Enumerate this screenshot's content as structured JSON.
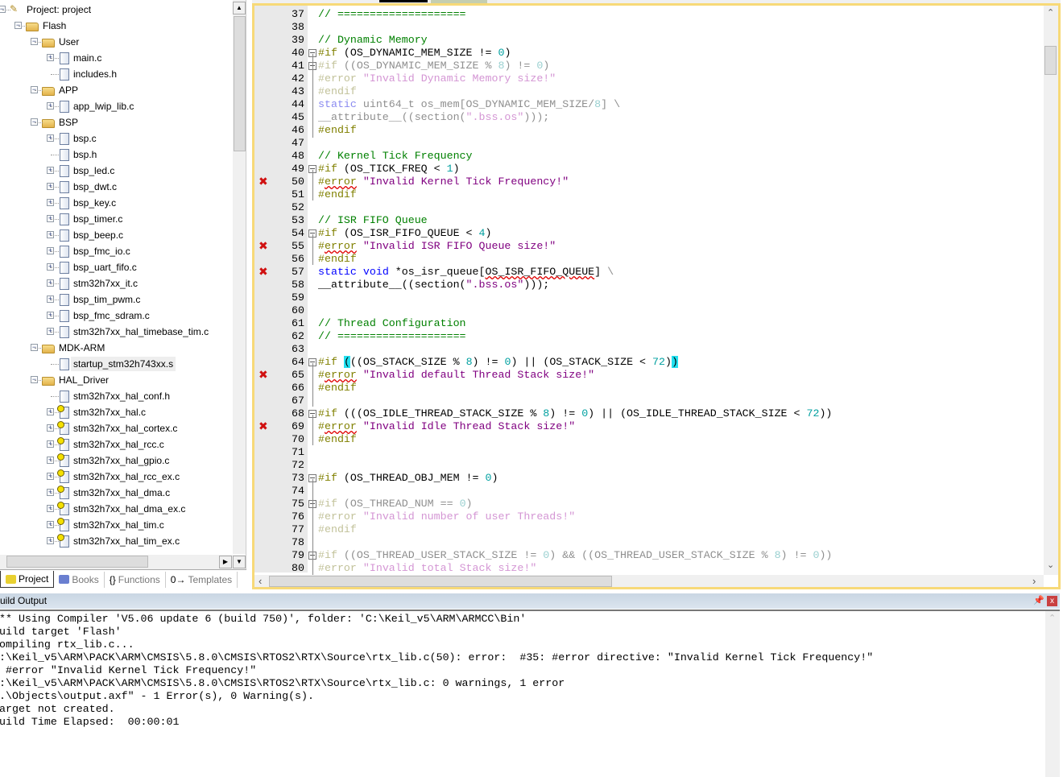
{
  "project_tree": [
    {
      "level": 0,
      "type": "project",
      "label": "Project: project",
      "exp": "-"
    },
    {
      "level": 1,
      "type": "target",
      "label": "Flash",
      "exp": "-"
    },
    {
      "level": 2,
      "type": "folder",
      "label": "User",
      "exp": "-"
    },
    {
      "level": 3,
      "type": "file",
      "label": "main.c",
      "exp": "+"
    },
    {
      "level": 3,
      "type": "file",
      "label": "includes.h",
      "exp": ""
    },
    {
      "level": 2,
      "type": "folder",
      "label": "APP",
      "exp": "-"
    },
    {
      "level": 3,
      "type": "file",
      "label": "app_lwip_lib.c",
      "exp": "+"
    },
    {
      "level": 2,
      "type": "folder",
      "label": "BSP",
      "exp": "-"
    },
    {
      "level": 3,
      "type": "file",
      "label": "bsp.c",
      "exp": "+"
    },
    {
      "level": 3,
      "type": "file",
      "label": "bsp.h",
      "exp": ""
    },
    {
      "level": 3,
      "type": "file",
      "label": "bsp_led.c",
      "exp": "+"
    },
    {
      "level": 3,
      "type": "file",
      "label": "bsp_dwt.c",
      "exp": "+"
    },
    {
      "level": 3,
      "type": "file",
      "label": "bsp_key.c",
      "exp": "+"
    },
    {
      "level": 3,
      "type": "file",
      "label": "bsp_timer.c",
      "exp": "+"
    },
    {
      "level": 3,
      "type": "file",
      "label": "bsp_beep.c",
      "exp": "+"
    },
    {
      "level": 3,
      "type": "file",
      "label": "bsp_fmc_io.c",
      "exp": "+"
    },
    {
      "level": 3,
      "type": "file",
      "label": "bsp_uart_fifo.c",
      "exp": "+"
    },
    {
      "level": 3,
      "type": "file",
      "label": "stm32h7xx_it.c",
      "exp": "+"
    },
    {
      "level": 3,
      "type": "file",
      "label": "bsp_tim_pwm.c",
      "exp": "+"
    },
    {
      "level": 3,
      "type": "file",
      "label": "bsp_fmc_sdram.c",
      "exp": "+"
    },
    {
      "level": 3,
      "type": "file",
      "label": "stm32h7xx_hal_timebase_tim.c",
      "exp": "+"
    },
    {
      "level": 2,
      "type": "folder",
      "label": "MDK-ARM",
      "exp": "-"
    },
    {
      "level": 3,
      "type": "file",
      "label": "startup_stm32h743xx.s",
      "exp": "",
      "selected": true
    },
    {
      "level": 2,
      "type": "folder",
      "label": "HAL_Driver",
      "exp": "-"
    },
    {
      "level": 3,
      "type": "file",
      "label": "stm32h7xx_hal_conf.h",
      "exp": ""
    },
    {
      "level": 3,
      "type": "keyfile",
      "label": "stm32h7xx_hal.c",
      "exp": "+"
    },
    {
      "level": 3,
      "type": "keyfile",
      "label": "stm32h7xx_hal_cortex.c",
      "exp": "+"
    },
    {
      "level": 3,
      "type": "keyfile",
      "label": "stm32h7xx_hal_rcc.c",
      "exp": "+"
    },
    {
      "level": 3,
      "type": "keyfile",
      "label": "stm32h7xx_hal_gpio.c",
      "exp": "+"
    },
    {
      "level": 3,
      "type": "keyfile",
      "label": "stm32h7xx_hal_rcc_ex.c",
      "exp": "+"
    },
    {
      "level": 3,
      "type": "keyfile",
      "label": "stm32h7xx_hal_dma.c",
      "exp": "+"
    },
    {
      "level": 3,
      "type": "keyfile",
      "label": "stm32h7xx_hal_dma_ex.c",
      "exp": "+"
    },
    {
      "level": 3,
      "type": "keyfile",
      "label": "stm32h7xx_hal_tim.c",
      "exp": "+"
    },
    {
      "level": 3,
      "type": "keyfile",
      "label": "stm32h7xx_hal_tim_ex.c",
      "exp": "+"
    }
  ],
  "left_tabs": [
    {
      "label": "Project",
      "icon": "project-icon",
      "active": true
    },
    {
      "label": "Books",
      "icon": "books-icon"
    },
    {
      "label": "Functions",
      "icon": "functions-icon",
      "glyph": "{}"
    },
    {
      "label": "Templates",
      "icon": "templates-icon",
      "glyph": "0→"
    }
  ],
  "editor": {
    "lines": [
      {
        "n": "37",
        "tokens": [
          [
            "c",
            "// ===================="
          ]
        ]
      },
      {
        "n": "38",
        "tokens": []
      },
      {
        "n": "39",
        "tokens": [
          [
            "c",
            "// Dynamic Memory"
          ]
        ]
      },
      {
        "n": "40",
        "fold": "box",
        "tokens": [
          [
            "p",
            "#if"
          ],
          [
            "t",
            " (OS_DYNAMIC_MEM_SIZE != "
          ],
          [
            "n",
            "0"
          ],
          [
            "t",
            ")"
          ]
        ]
      },
      {
        "n": "41",
        "fold": "box",
        "tokens": [
          [
            "pi",
            "#if"
          ],
          [
            "ti",
            " ((OS_DYNAMIC_MEM_SIZE % "
          ],
          [
            "ni",
            "8"
          ],
          [
            "ti",
            ") != "
          ],
          [
            "ni",
            "0"
          ],
          [
            "ti",
            ")"
          ]
        ]
      },
      {
        "n": "42",
        "tokens": [
          [
            "pi",
            "#error"
          ],
          [
            "ti",
            " "
          ],
          [
            "si",
            "\"Invalid Dynamic Memory size!\""
          ]
        ]
      },
      {
        "n": "43",
        "tokens": [
          [
            "pi",
            "#endif"
          ]
        ]
      },
      {
        "n": "44",
        "tokens": [
          [
            "ki",
            "static"
          ],
          [
            "ti",
            " uint64_t os_mem[OS_DYNAMIC_MEM_SIZE/"
          ],
          [
            "ni",
            "8"
          ],
          [
            "ti",
            "] \\"
          ]
        ]
      },
      {
        "n": "45",
        "tokens": [
          [
            "ti",
            "__attribute__((section("
          ],
          [
            "si",
            "\".bss.os\""
          ],
          [
            "ti",
            ")));"
          ]
        ]
      },
      {
        "n": "46",
        "tokens": [
          [
            "p",
            "#endif"
          ]
        ]
      },
      {
        "n": "47",
        "tokens": []
      },
      {
        "n": "48",
        "tokens": [
          [
            "c",
            "// Kernel Tick Frequency"
          ]
        ]
      },
      {
        "n": "49",
        "fold": "box",
        "tokens": [
          [
            "p",
            "#if"
          ],
          [
            "t",
            " (OS_TICK_FREQ < "
          ],
          [
            "n",
            "1"
          ],
          [
            "t",
            ")"
          ]
        ]
      },
      {
        "n": "50",
        "error": true,
        "tokens": [
          [
            "p",
            "#"
          ],
          [
            "pe",
            "error"
          ],
          [
            "t",
            " "
          ],
          [
            "s",
            "\"Invalid Kernel Tick Frequency!\""
          ]
        ]
      },
      {
        "n": "51",
        "tokens": [
          [
            "p",
            "#endif"
          ]
        ]
      },
      {
        "n": "52",
        "tokens": []
      },
      {
        "n": "53",
        "tokens": [
          [
            "c",
            "// ISR FIFO Queue"
          ]
        ]
      },
      {
        "n": "54",
        "fold": "box",
        "tokens": [
          [
            "p",
            "#if"
          ],
          [
            "t",
            " (OS_ISR_FIFO_QUEUE < "
          ],
          [
            "n",
            "4"
          ],
          [
            "t",
            ")"
          ]
        ]
      },
      {
        "n": "55",
        "error": true,
        "tokens": [
          [
            "p",
            "#"
          ],
          [
            "pe",
            "error"
          ],
          [
            "t",
            " "
          ],
          [
            "s",
            "\"Invalid ISR FIFO Queue size!\""
          ]
        ]
      },
      {
        "n": "56",
        "tokens": [
          [
            "p",
            "#endif"
          ]
        ]
      },
      {
        "n": "57",
        "error": true,
        "tokens": [
          [
            "k",
            "static"
          ],
          [
            "t",
            " "
          ],
          [
            "k",
            "void"
          ],
          [
            "t",
            " *os_isr_queue["
          ],
          [
            "te",
            "OS_ISR_FIFO_QUEUE"
          ],
          [
            "t",
            "] "
          ],
          [
            "ti",
            "\\"
          ]
        ]
      },
      {
        "n": "58",
        "tokens": [
          [
            "t",
            "__attribute__((section("
          ],
          [
            "s",
            "\".bss.os\""
          ],
          [
            "t",
            ")));"
          ]
        ]
      },
      {
        "n": "59",
        "tokens": []
      },
      {
        "n": "60",
        "tokens": []
      },
      {
        "n": "61",
        "tokens": [
          [
            "c",
            "// Thread Configuration"
          ]
        ]
      },
      {
        "n": "62",
        "tokens": [
          [
            "c",
            "// ===================="
          ]
        ]
      },
      {
        "n": "63",
        "tokens": []
      },
      {
        "n": "64",
        "fold": "box",
        "tokens": [
          [
            "p",
            "#if"
          ],
          [
            "t",
            " "
          ],
          [
            "h",
            "("
          ],
          [
            "t",
            "((OS_STACK_SIZE % "
          ],
          [
            "n",
            "8"
          ],
          [
            "t",
            ") != "
          ],
          [
            "n",
            "0"
          ],
          [
            "t",
            ") || (OS_STACK_SIZE < "
          ],
          [
            "n",
            "72"
          ],
          [
            "t",
            ")"
          ],
          [
            "h",
            ")"
          ]
        ]
      },
      {
        "n": "65",
        "error": true,
        "tokens": [
          [
            "p",
            "#"
          ],
          [
            "pe",
            "error"
          ],
          [
            "t",
            " "
          ],
          [
            "s",
            "\"Invalid default Thread Stack size!\""
          ]
        ]
      },
      {
        "n": "66",
        "tokens": [
          [
            "p",
            "#endif"
          ]
        ]
      },
      {
        "n": "67",
        "tokens": []
      },
      {
        "n": "68",
        "fold": "box",
        "tokens": [
          [
            "p",
            "#if"
          ],
          [
            "t",
            " (((OS_IDLE_THREAD_STACK_SIZE % "
          ],
          [
            "n",
            "8"
          ],
          [
            "t",
            ") != "
          ],
          [
            "n",
            "0"
          ],
          [
            "t",
            ") || (OS_IDLE_THREAD_STACK_SIZE < "
          ],
          [
            "n",
            "72"
          ],
          [
            "t",
            "))"
          ]
        ]
      },
      {
        "n": "69",
        "error": true,
        "tokens": [
          [
            "p",
            "#"
          ],
          [
            "pe",
            "error"
          ],
          [
            "t",
            " "
          ],
          [
            "s",
            "\"Invalid Idle Thread Stack size!\""
          ]
        ]
      },
      {
        "n": "70",
        "tokens": [
          [
            "p",
            "#endif"
          ]
        ]
      },
      {
        "n": "71",
        "tokens": []
      },
      {
        "n": "72",
        "tokens": []
      },
      {
        "n": "73",
        "fold": "box",
        "tokens": [
          [
            "p",
            "#if"
          ],
          [
            "t",
            " (OS_THREAD_OBJ_MEM != "
          ],
          [
            "n",
            "0"
          ],
          [
            "t",
            ")"
          ]
        ]
      },
      {
        "n": "74",
        "tokens": []
      },
      {
        "n": "75",
        "fold": "box",
        "tokens": [
          [
            "pi",
            "#if"
          ],
          [
            "ti",
            " (OS_THREAD_NUM == "
          ],
          [
            "ni",
            "0"
          ],
          [
            "ti",
            ")"
          ]
        ]
      },
      {
        "n": "76",
        "tokens": [
          [
            "pi",
            "#error"
          ],
          [
            "ti",
            " "
          ],
          [
            "si",
            "\"Invalid number of user Threads!\""
          ]
        ]
      },
      {
        "n": "77",
        "tokens": [
          [
            "pi",
            "#endif"
          ]
        ]
      },
      {
        "n": "78",
        "tokens": []
      },
      {
        "n": "79",
        "fold": "box",
        "tokens": [
          [
            "pi",
            "#if"
          ],
          [
            "ti",
            " ((OS_THREAD_USER_STACK_SIZE != "
          ],
          [
            "ni",
            "0"
          ],
          [
            "ti",
            ") && ((OS_THREAD_USER_STACK_SIZE % "
          ],
          [
            "ni",
            "8"
          ],
          [
            "ti",
            ") != "
          ],
          [
            "ni",
            "0"
          ],
          [
            "ti",
            "))"
          ]
        ]
      },
      {
        "n": "80",
        "tokens": [
          [
            "pi",
            "#error"
          ],
          [
            "ti",
            " "
          ],
          [
            "si",
            "\"Invalid total Stack size!\""
          ]
        ]
      }
    ]
  },
  "build_output": {
    "title": "uild Output",
    "lines": [
      "** Using Compiler 'V5.06 update 6 (build 750)', folder: 'C:\\Keil_v5\\ARM\\ARMCC\\Bin'",
      "uild target 'Flash'",
      "ompiling rtx_lib.c...",
      ":\\Keil_v5\\ARM\\PACK\\ARM\\CMSIS\\5.8.0\\CMSIS\\RTOS2\\RTX\\Source\\rtx_lib.c(50): error:  #35: #error directive: \"Invalid Kernel Tick Frequency!\"",
      " #error \"Invalid Kernel Tick Frequency!\"",
      ":\\Keil_v5\\ARM\\PACK\\ARM\\CMSIS\\5.8.0\\CMSIS\\RTOS2\\RTX\\Source\\rtx_lib.c: 0 warnings, 1 error",
      ".\\Objects\\output.axf\" - 1 Error(s), 0 Warning(s).",
      "arget not created.",
      "uild Time Elapsed:  00:00:01"
    ]
  },
  "colors": {
    "editor_border": "#f7d978",
    "error_marker": "#d01010",
    "bracket_highlight": "#22e0f0"
  }
}
